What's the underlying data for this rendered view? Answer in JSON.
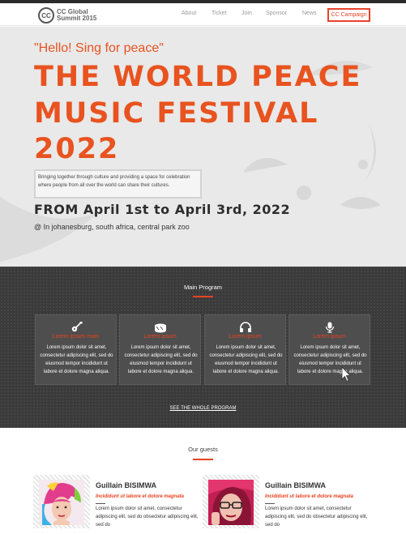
{
  "nav": {
    "logo_mark": "CC",
    "logo_line1": "CC Global",
    "logo_line2": "Summit 2015",
    "items": [
      "About",
      "Ticket",
      "Join",
      "Sponsor",
      "News"
    ],
    "cta": "CC Campaign"
  },
  "hero": {
    "hello": "\"Hello! Sing for peace\"",
    "title_line1": "THE WORLD PEACE",
    "title_line2": "MUSIC FESTIVAL",
    "title_line3": "2022",
    "tagline": "Bringing together through culture and providing a space for celebration where people from all over the world can share their cultures.",
    "dates": "FROM April 1st to April 3rd, 2022",
    "place": "@ In johanesburg, south africa, central park zoo"
  },
  "program": {
    "title": "Main Program",
    "cards": [
      {
        "icon": "guitar-icon",
        "title": "Lorem ipsum main",
        "text": "Lorem ipsum dolor sit amet, consectetur adipiscing elit, sed do eiusmod tempor incididunt ut labore et dolore magna aliqua."
      },
      {
        "icon": "drum-icon",
        "title": "Lorem ipsum",
        "text": "Lorem ipsum dolor sit amet, consectetur adipiscing elit, sed do eiusmod tempor incididunt ut labore et dolore magna aliqua."
      },
      {
        "icon": "headphones-icon",
        "title": "Lorem ipsum",
        "text": "Lorem ipsum dolor sit amet, consectetur adipiscing elit, sed do eiusmod tempor incididunt ut labore et dolore magna aliqua."
      },
      {
        "icon": "microphone-icon",
        "title": "Lorem ipsum",
        "text": "Lorem ipsum dolor sit amet, consectetur adipiscing elit, sed do eiusmod tempor incididunt ut labore et dolore magna aliqua."
      }
    ],
    "link": "SEE THE WHOLE PROGRAM"
  },
  "guests": {
    "title": "Our guests",
    "items": [
      {
        "name": "Guillain BISIMWA",
        "role": "Incididunt ut labore et dolore magnata",
        "bio": "Lorem ipsum dolor sit amet, consectetur adipiscing elit, sed do obsectetur adipiscing elit, sed do"
      },
      {
        "name": "Guillain BISIMWA",
        "role": "Incididunt ut labore et dolore magnata",
        "bio": "Lorem ipsum dolor sit amet, consectetur adipiscing elit, sed do obsectetur adipiscing elit, sed do"
      }
    ]
  },
  "colors": {
    "accent": "#e8531f",
    "cta_border": "#e8432c",
    "dark_section": "#3a3a3a"
  }
}
